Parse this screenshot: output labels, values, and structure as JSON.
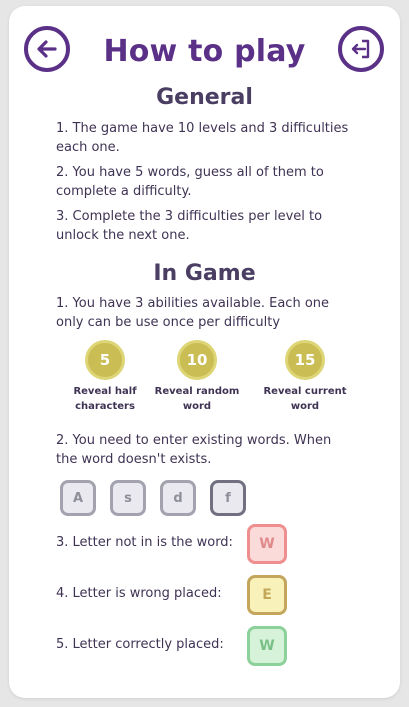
{
  "header": {
    "title": "How to play",
    "back_icon": "arrow-left-circle-icon",
    "exit_icon": "sign-out-icon"
  },
  "general": {
    "title": "General",
    "rules": [
      "1. The game have 10 levels and 3 difficulties each one.",
      "2. You have 5 words, guess all of them to complete a difficulty.",
      "3. Complete the 3 difficulties per level to unlock the next one."
    ]
  },
  "in_game": {
    "title": "In Game",
    "rule1": "1. You have 3 abilities available. Each one only can be use once per difficulty",
    "abilities": [
      {
        "cost": "5",
        "label": "Reveal half characters"
      },
      {
        "cost": "10",
        "label": "Reveal random word"
      },
      {
        "cost": "15",
        "label": "Reveal current word"
      }
    ],
    "rule2": "2. You need to enter existing words. When the word doesn't exists.",
    "example_keys": [
      "A",
      "s",
      "d",
      "f"
    ],
    "legend": [
      {
        "text": "3. Letter not in is the word:",
        "letter": "W",
        "color": "#ef8e8e"
      },
      {
        "text": "4. Letter is wrong placed:",
        "letter": "E",
        "color": "#c3a65c"
      },
      {
        "text": "5. Letter correctly placed:",
        "letter": "W",
        "color": "#8cd09a"
      }
    ]
  },
  "colors": {
    "accent": "#5b3188",
    "coin": "#c9bd54"
  }
}
